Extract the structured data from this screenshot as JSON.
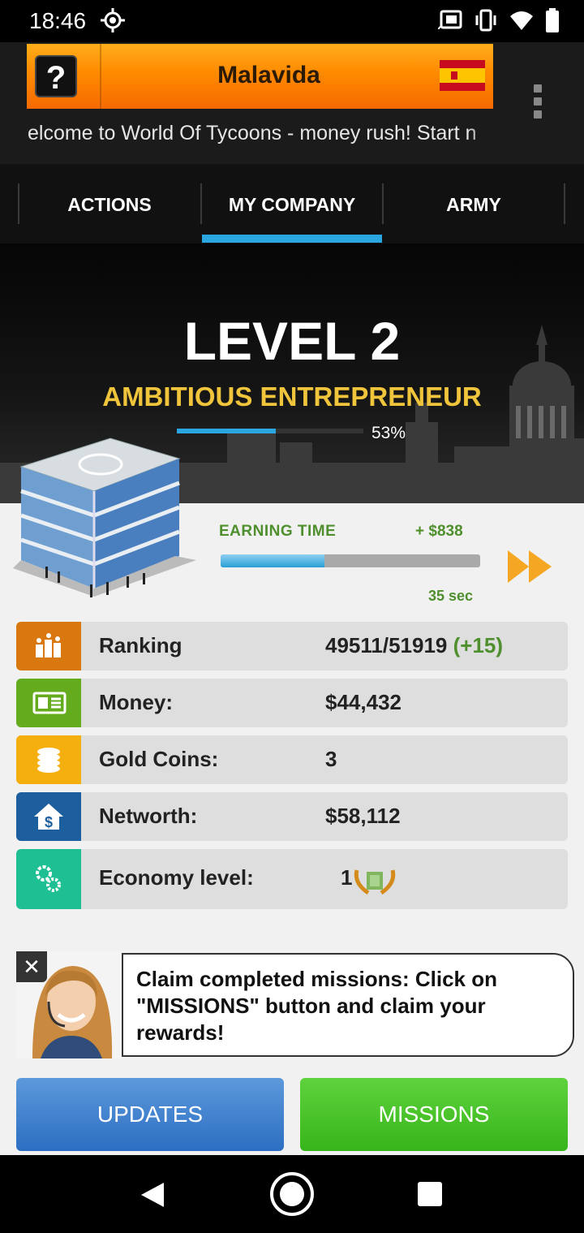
{
  "status_bar": {
    "time": "18:46",
    "icons": [
      "gear-icon",
      "cast-icon",
      "vibrate-icon",
      "wifi-icon",
      "battery-icon"
    ]
  },
  "banner": {
    "help_label": "?",
    "title": "Malavida",
    "flag": "spain-flag-icon"
  },
  "ticker": {
    "text": "elcome to World Of Tycoons - money rush! Start n"
  },
  "tabs": [
    {
      "label": "ACTIONS",
      "active": false
    },
    {
      "label": "MY COMPANY",
      "active": true
    },
    {
      "label": "ARMY",
      "active": false
    }
  ],
  "level": {
    "title": "LEVEL 2",
    "rank": "AMBITIOUS ENTREPRENEUR",
    "progress_label": "53%",
    "progress": 0.53
  },
  "earning": {
    "label": "EARNING TIME",
    "amount": "+ $838",
    "time_left": "35 sec",
    "progress": 0.4
  },
  "stats": [
    {
      "label": "Ranking",
      "value": "49511/51919",
      "delta": "(+15)",
      "icon": "ranking-icon",
      "color": "#d9780f"
    },
    {
      "label": "Money:",
      "value": "$44,432",
      "icon": "money-icon",
      "color": "#64ac1e"
    },
    {
      "label": "Gold Coins:",
      "value": "3",
      "icon": "coins-icon",
      "color": "#f4ae0e"
    },
    {
      "label": "Networth:",
      "value": "$58,112",
      "icon": "house-dollar-icon",
      "color": "#1d5f9e"
    },
    {
      "label": "Economy level:",
      "value": "1",
      "icon": "gears-icon",
      "color": "#1ebf93"
    }
  ],
  "hint": {
    "text": "Claim completed missions: Click on \"MISSIONS\" button and claim your rewards!",
    "close_label": "✕"
  },
  "buttons": {
    "updates": "UPDATES",
    "missions": "MISSIONS"
  },
  "colors": {
    "accent_blue": "#2aa7e0",
    "rank_gold": "#f0c53c",
    "earning_green": "#4f8f2e",
    "missions_green": "#46c224",
    "updates_blue": "#3f82cf"
  }
}
